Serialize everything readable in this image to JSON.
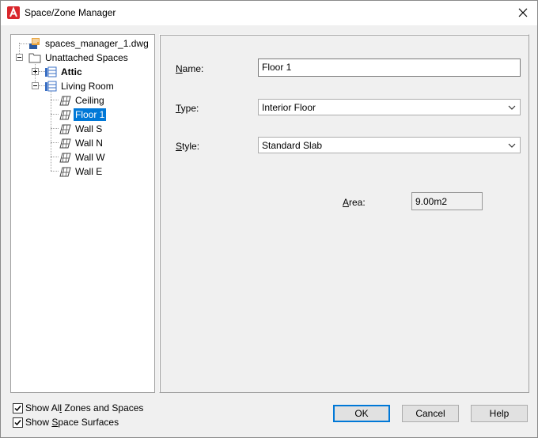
{
  "window": {
    "title": "Space/Zone Manager"
  },
  "tree": {
    "root": "spaces_manager_1.dwg",
    "group": "Unattached Spaces",
    "attic": "Attic",
    "living_room": "Living Room",
    "surfaces": [
      "Ceiling",
      "Floor 1",
      "Wall S",
      "Wall N",
      "Wall W",
      "Wall E"
    ]
  },
  "props": {
    "name_label_pre": "N",
    "name_label_post": "ame:",
    "name_value": "Floor 1",
    "type_label_pre": "T",
    "type_label_post": "ype:",
    "type_value": "Interior Floor",
    "style_label_pre": "S",
    "style_label_post": "tyle:",
    "style_value": "Standard Slab",
    "area_label_pre": "A",
    "area_label_post": "rea:",
    "area_value": "9.00m2"
  },
  "options": {
    "show_all_pre": "Show Al",
    "show_all_u": "l",
    "show_all_post": " Zones and Spaces",
    "show_surf_pre": "Show ",
    "show_surf_u": "S",
    "show_surf_post": "pace Surfaces"
  },
  "buttons": {
    "ok": "OK",
    "cancel": "Cancel",
    "help": "Help"
  },
  "colors": {
    "selection": "#0078d7",
    "accent_red": "#d9262c"
  }
}
